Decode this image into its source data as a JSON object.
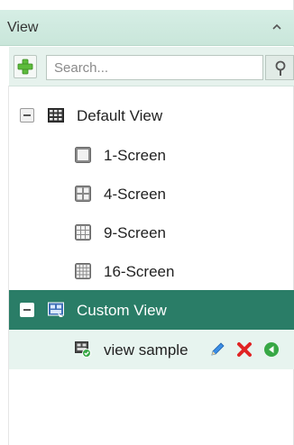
{
  "header": {
    "title": "View"
  },
  "toolbar": {
    "search_placeholder": "Search..."
  },
  "tree": {
    "default_view": {
      "label": "Default View",
      "children": [
        {
          "label": "1-Screen",
          "icon": "grid-1-icon"
        },
        {
          "label": "4-Screen",
          "icon": "grid-4-icon"
        },
        {
          "label": "9-Screen",
          "icon": "grid-9-icon"
        },
        {
          "label": "16-Screen",
          "icon": "grid-16-icon"
        }
      ]
    },
    "custom_view": {
      "label": "Custom View",
      "children": [
        {
          "label": "view sample"
        }
      ]
    }
  },
  "colors": {
    "header_bg": "#d1ebe1",
    "selected_row": "#2a7d67",
    "edit": "#3a8ee6",
    "delete": "#e02424",
    "play": "#37a845"
  }
}
